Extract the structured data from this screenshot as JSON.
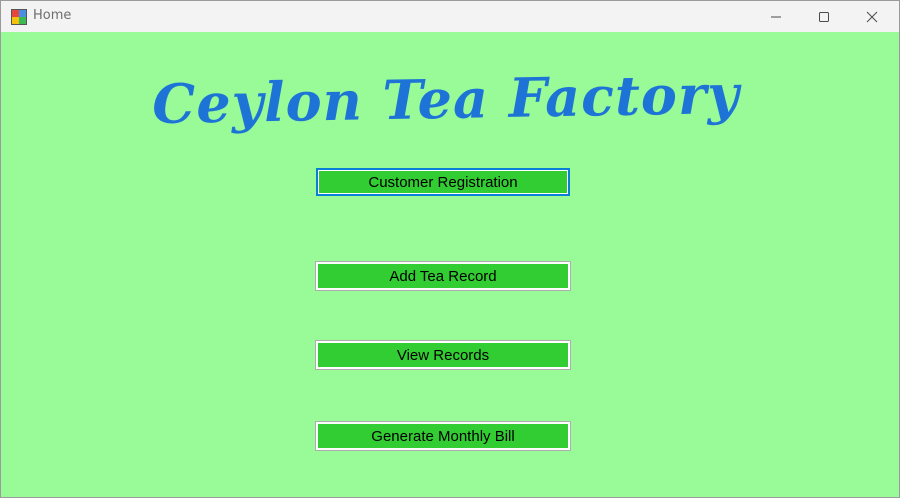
{
  "window": {
    "title": "Home",
    "controls": {
      "minimize": "minimize-icon",
      "maximize": "maximize-icon",
      "close": "close-icon"
    }
  },
  "main": {
    "heading": "Ceylon Tea Factory",
    "buttons": [
      {
        "label": "Customer Registration",
        "focused": true
      },
      {
        "label": "Add Tea Record",
        "focused": false
      },
      {
        "label": "View Records",
        "focused": false
      },
      {
        "label": "Generate Monthly Bill",
        "focused": false
      }
    ]
  },
  "colors": {
    "background": "#98fb98",
    "button": "#32cd32",
    "heading": "#1e74d6",
    "focus_border": "#0a7fd8"
  }
}
